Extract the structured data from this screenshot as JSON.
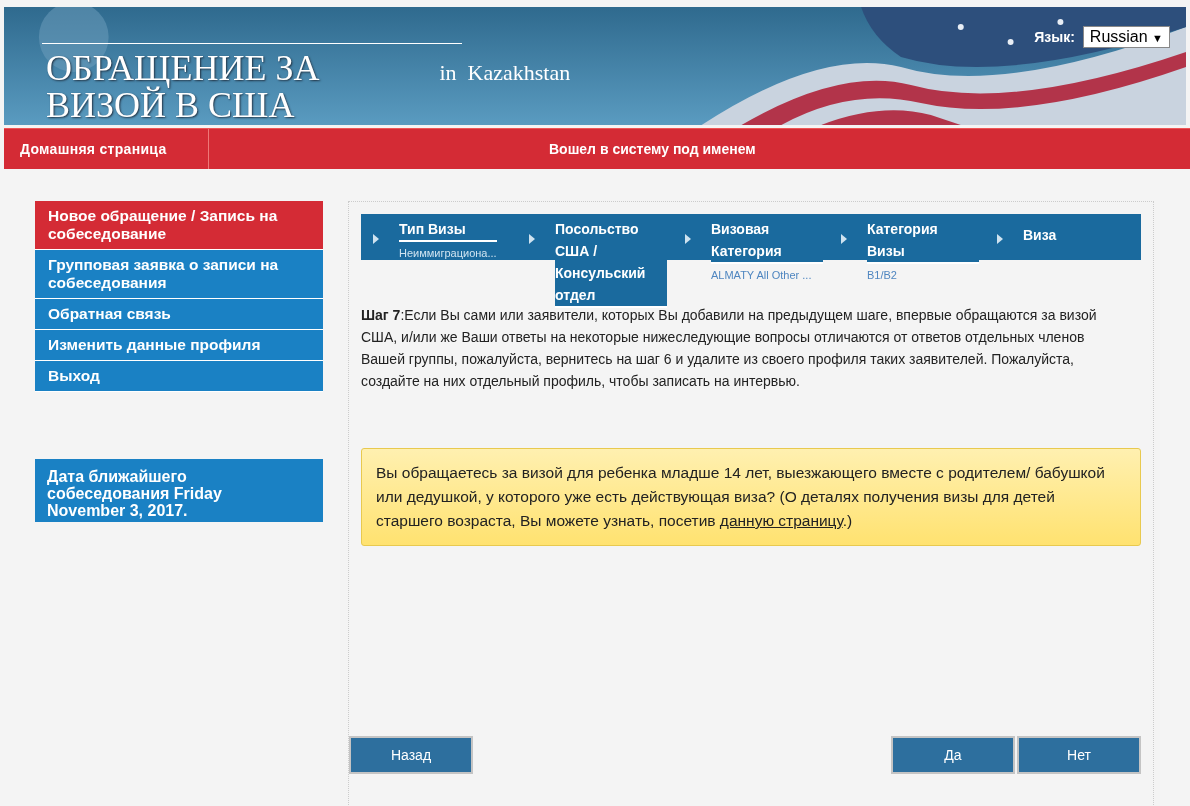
{
  "header": {
    "title_line_1": "ОБРАЩЕНИЕ ЗА",
    "title_line_2": "ВИЗОЙ В США",
    "country": "in  Kazakhstan",
    "language_label": "Язык:",
    "language": "Russian",
    "language_caret": "▼"
  },
  "nav": {
    "home": "Домашняя страница",
    "logged_in": "Вошел в систему под именем"
  },
  "sidebar": {
    "items": [
      {
        "label": "Новое обращение / Запись на собеседование",
        "selected": true
      },
      {
        "label": "Групповая заявка о записи на собеседования",
        "selected": false
      },
      {
        "label": "Обратная связь",
        "selected": false
      },
      {
        "label": "Изменить данные профиля",
        "selected": false
      },
      {
        "label": "Выход",
        "selected": false
      }
    ],
    "appointment": "Дата ближайшего собеседования Friday November 3, 2017."
  },
  "steps": [
    {
      "title": "Тип Визы",
      "value": "Неиммиграциона..."
    },
    {
      "title": "Посольство США / Консульский отдел"
    },
    {
      "title": "Визовая Категория",
      "value": "ALMATY All Other ..."
    },
    {
      "title": "Категория Визы",
      "value": "B1/B2"
    },
    {
      "title": "Виза"
    }
  ],
  "instruction": "**Шаг 7**:Если Вы сами или заявители, которых Вы добавили на предыдущем шаге, впервые обращаются за визой США, и/или же Ваши ответы на некоторые нижеследующие вопросы отличаются от ответов отдельных членов Вашей группы, пожалуйста, вернитесь на шаг 6 и удалите из своего профиля таких заявителей. Пожалуйста, создайте на них отдельный профиль, чтобы записать на интервью.",
  "question": {
    "text": "Вы обращаетесь за визой для ребенка младше 14 лет, выезжающего вместе с родителем/ бабушкой или дедушкой, у которого уже есть действующая виза? (О деталях получения визы для детей старшего возраста, Вы можете узнать, посетив",
    "link": "данную страницу",
    "after": ".)"
  },
  "buttons": {
    "back": "Назад",
    "yes": "Да",
    "no": "Нет"
  }
}
